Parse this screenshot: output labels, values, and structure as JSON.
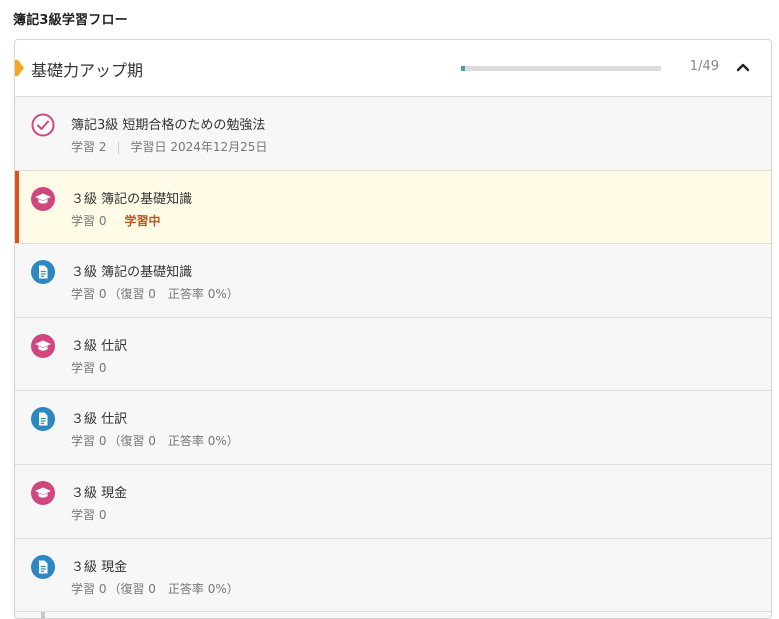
{
  "page": {
    "title": "簿記3級学習フロー"
  },
  "phase": {
    "title": "基礎力アップ期",
    "progress_fraction": 0.0204,
    "count_text": "1/49",
    "expanded": true
  },
  "colors": {
    "completed_icon": "#d0467f",
    "lecture_icon": "#d0467f",
    "exercise_icon": "#2d87c1",
    "active_bar": "#d9531e",
    "active_bg": "#fffbe6",
    "status_text": "#c0571d",
    "marker": "#f5a623"
  },
  "items": [
    {
      "type": "completed",
      "icon": "check-circle-icon",
      "title": "簿記3級 短期合格のための勉強法",
      "study": "学習 2",
      "study_date": "学習日 2024年12月25日"
    },
    {
      "type": "lecture",
      "icon": "graduation-cap-icon",
      "title": "３級 簿記の基礎知識",
      "study": "学習 0",
      "status": "学習中",
      "active": true
    },
    {
      "type": "exercise",
      "icon": "document-icon",
      "title": "３級 簿記の基礎知識",
      "study": "学習 0",
      "review": "（復習 0",
      "accuracy": "正答率 0%）"
    },
    {
      "type": "lecture",
      "icon": "graduation-cap-icon",
      "title": "３級 仕訳",
      "study": "学習 0"
    },
    {
      "type": "exercise",
      "icon": "document-icon",
      "title": "３級 仕訳",
      "study": "学習 0",
      "review": "（復習 0",
      "accuracy": "正答率 0%）"
    },
    {
      "type": "lecture",
      "icon": "graduation-cap-icon",
      "title": "３級 現金",
      "study": "学習 0"
    },
    {
      "type": "exercise",
      "icon": "document-icon",
      "title": "３級 現金",
      "study": "学習 0",
      "review": "（復習 0",
      "accuracy": "正答率 0%）"
    }
  ]
}
